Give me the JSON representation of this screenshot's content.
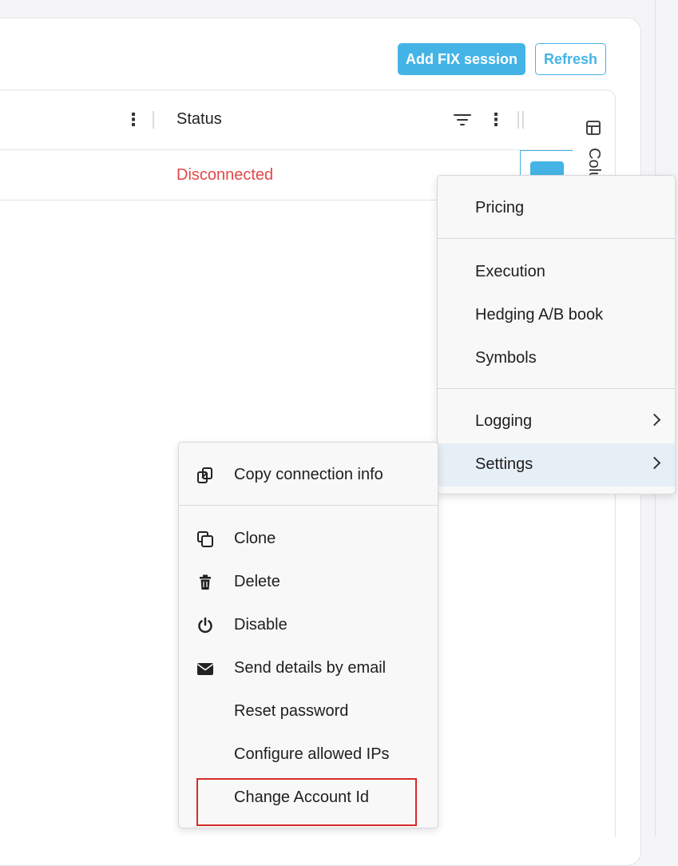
{
  "toolbar": {
    "add_label": "Add FIX session",
    "refresh_label": "Refresh"
  },
  "grid": {
    "status_header": "Status",
    "row": {
      "status": "Disconnected"
    }
  },
  "side_panel": {
    "label": "Columns"
  },
  "row_menu": {
    "items": [
      {
        "label": "Copy connection info",
        "icon": "copy-link-icon"
      },
      {
        "label": "Clone",
        "icon": "clone-icon"
      },
      {
        "label": "Delete",
        "icon": "trash-icon"
      },
      {
        "label": "Disable",
        "icon": "power-icon"
      },
      {
        "label": "Send details by email",
        "icon": "envelope-icon"
      },
      {
        "label": "Reset password"
      },
      {
        "label": "Configure allowed IPs"
      },
      {
        "label": "Change Account Id"
      }
    ]
  },
  "submenu": {
    "items": [
      {
        "label": "Pricing"
      },
      {
        "label": "Execution"
      },
      {
        "label": "Hedging A/B book"
      },
      {
        "label": "Symbols"
      },
      {
        "label": "Logging",
        "has_submenu": true
      },
      {
        "label": "Settings",
        "has_submenu": true,
        "active": true
      }
    ]
  },
  "colors": {
    "accent": "#44b4e6",
    "status_error": "#e04848",
    "highlight": "#d62a2a",
    "menu_active": "#e6eef6"
  }
}
